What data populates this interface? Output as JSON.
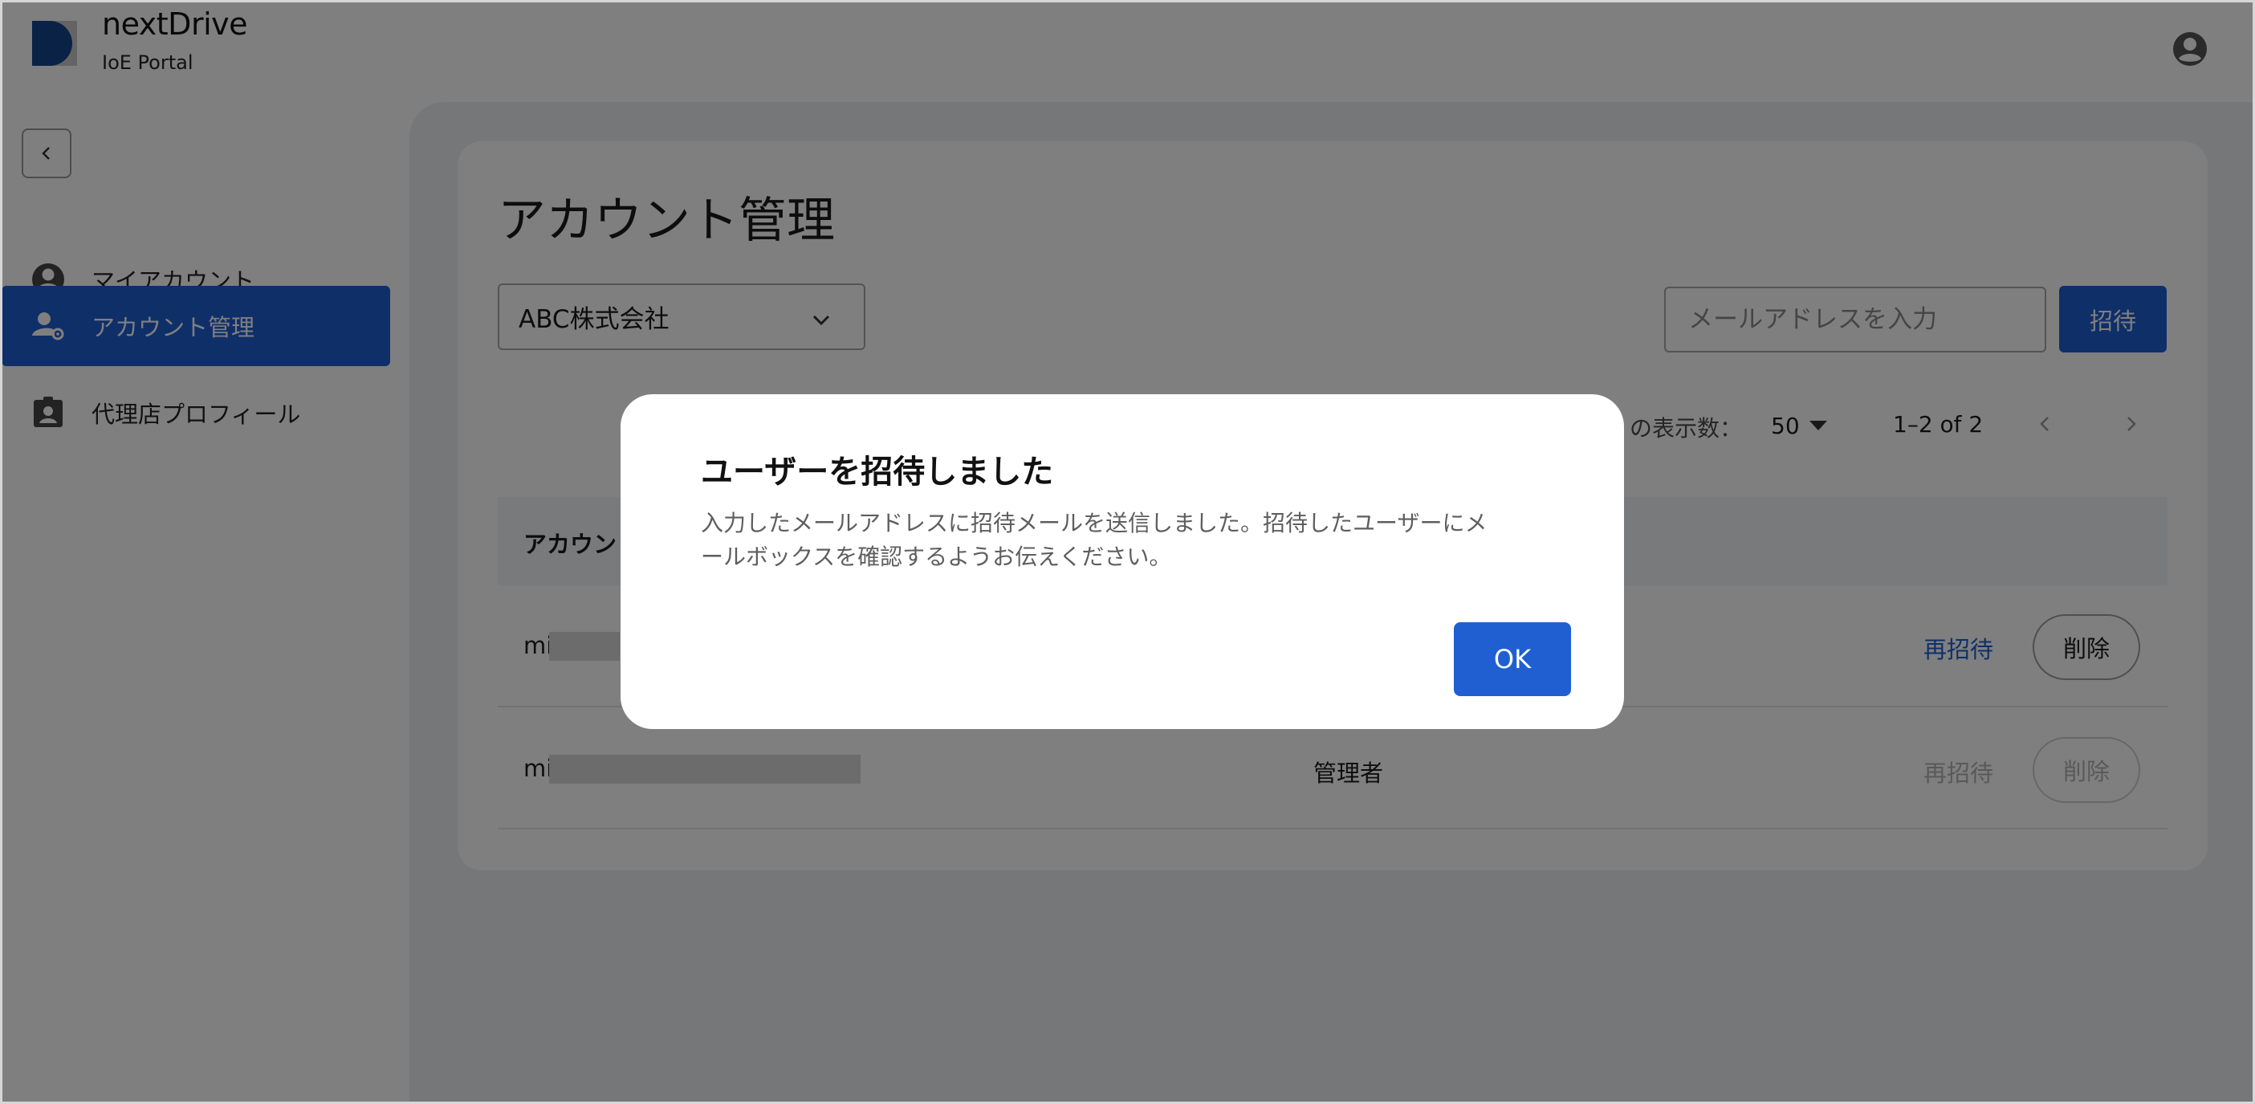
{
  "brand": {
    "name": "nextDrive",
    "subtitle": "IoE Portal"
  },
  "sidebar": {
    "items": [
      {
        "label": "マイアカウント",
        "icon": "account-circle-icon",
        "active": false
      },
      {
        "label": "アカウント管理",
        "icon": "manage-accounts-icon",
        "active": true
      },
      {
        "label": "代理店プロフィール",
        "icon": "contact-badge-icon",
        "active": false
      }
    ]
  },
  "main": {
    "title": "アカウント管理",
    "company_select": {
      "value": "ABC株式会社"
    },
    "invite": {
      "placeholder": "メールアドレスを入力",
      "button_label": "招待"
    },
    "pagination": {
      "rows_label": "の表示数：",
      "rows_value": "50",
      "range": "1–2 of 2"
    },
    "table": {
      "header_account": "アカウン",
      "rows": [
        {
          "email_prefix": "mi",
          "role": "",
          "reinvite_label": "再招待",
          "delete_label": "削除",
          "enabled": true
        },
        {
          "email_prefix": "mi",
          "role": "管理者",
          "reinvite_label": "再招待",
          "delete_label": "削除",
          "enabled": false
        }
      ]
    }
  },
  "dialog": {
    "title": "ユーザーを招待しました",
    "body_line1": "入力したメールアドレスに招待メールを送信しました。招待したユーザーにメ",
    "body_line2": "ールボックスを確認するようお伝えください。",
    "ok_label": "OK"
  },
  "colors": {
    "primary": "#1f5fd2",
    "main_background": "#eceff3",
    "overlay": "rgba(0,0,0,0.5)"
  }
}
